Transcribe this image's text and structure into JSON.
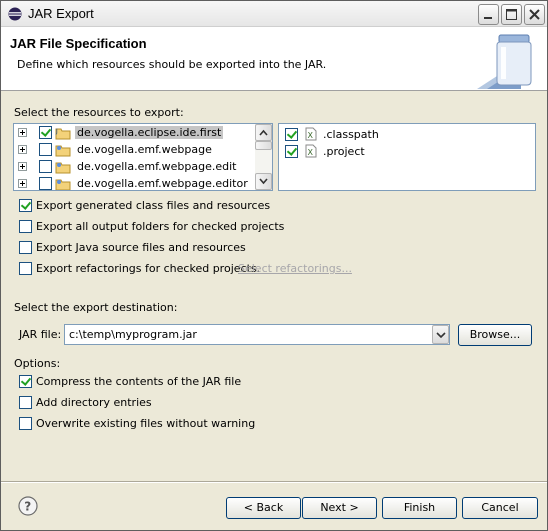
{
  "window": {
    "title": "JAR Export",
    "icon": "eclipse-icon"
  },
  "banner": {
    "title": "JAR File Specification",
    "description": "Define which resources should be exported into the JAR.",
    "image": "jar-image"
  },
  "resources": {
    "label": "Select the resources to export:",
    "projects": [
      {
        "label": "de.vogella.eclipse.ide.first",
        "checked": true,
        "selected": true
      },
      {
        "label": "de.vogella.emf.webpage",
        "checked": false
      },
      {
        "label": "de.vogella.emf.webpage.edit",
        "checked": false
      },
      {
        "label": "de.vogella.emf.webpage.editor",
        "checked": false
      }
    ],
    "files": [
      {
        "label": ".classpath",
        "checked": true
      },
      {
        "label": ".project",
        "checked": true
      }
    ]
  },
  "export_options": [
    {
      "label": "Export generated class files and resources",
      "checked": true
    },
    {
      "label": "Export all output folders for checked projects",
      "checked": false
    },
    {
      "label": "Export Java source files and resources",
      "checked": false
    },
    {
      "label": "Export refactorings for checked projects.",
      "checked": false
    }
  ],
  "select_refactorings_link": "Select refactorings...",
  "destination": {
    "label": "Select the export destination:",
    "jar_file_label": "JAR file:",
    "jar_file_value": "c:\\temp\\myprogram.jar",
    "browse_label": "Browse..."
  },
  "options": {
    "label": "Options:",
    "items": [
      {
        "label": "Compress the contents of the JAR file",
        "checked": true
      },
      {
        "label": "Add directory entries",
        "checked": false
      },
      {
        "label": "Overwrite existing files without warning",
        "checked": false
      }
    ]
  },
  "footer": {
    "back_label": "< Back",
    "next_label": "Next >",
    "finish_label": "Finish",
    "cancel_label": "Cancel"
  }
}
